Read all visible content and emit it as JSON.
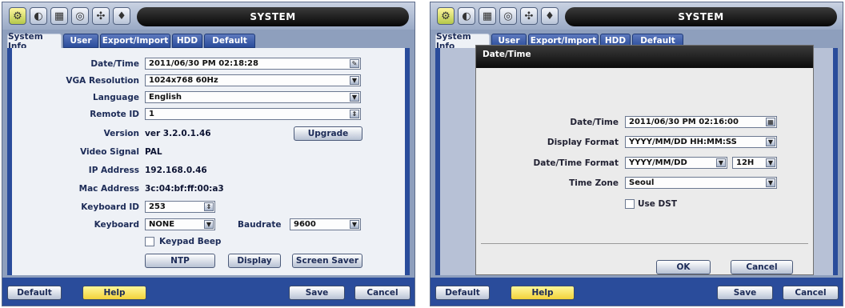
{
  "window": {
    "title": "SYSTEM"
  },
  "toolbar": {
    "icons": [
      "gear-icon",
      "monitor-icon",
      "calendar-icon",
      "camera-icon",
      "network-icon",
      "shield-icon"
    ]
  },
  "tabs": [
    "System Info",
    "User",
    "Export/Import",
    "HDD",
    "Default"
  ],
  "system_info": {
    "date_time_label": "Date/Time",
    "date_time_value": "2011/06/30 PM 02:18:28",
    "vga_label": "VGA Resolution",
    "vga_value": "1024x768  60Hz",
    "language_label": "Language",
    "language_value": "English",
    "remote_id_label": "Remote ID",
    "remote_id_value": "1",
    "version_label": "Version",
    "version_value": "ver 3.2.0.1.46",
    "upgrade_label": "Upgrade",
    "video_signal_label": "Video Signal",
    "video_signal_value": "PAL",
    "ip_label": "IP Address",
    "ip_value": "192.168.0.46",
    "mac_label": "Mac Address",
    "mac_value": "3c:04:bf:ff:00:a3",
    "keyboard_id_label": "Keyboard ID",
    "keyboard_id_value": "253",
    "keyboard_label": "Keyboard",
    "keyboard_value": "NONE",
    "baudrate_label": "Baudrate",
    "baudrate_value": "9600",
    "keypad_beep_label": "Keypad Beep",
    "ntp_label": "NTP",
    "display_label": "Display",
    "screen_saver_label": "Screen Saver"
  },
  "bottom": {
    "default_label": "Default",
    "help_label": "Help",
    "save_label": "Save",
    "cancel_label": "Cancel"
  },
  "dialog": {
    "title": "Date/Time",
    "date_time_label": "Date/Time",
    "date_time_value": "2011/06/30 PM 02:16:00",
    "display_format_label": "Display Format",
    "display_format_value": "YYYY/MM/DD HH:MM:SS",
    "date_time_format_label": "Date/Time Format",
    "date_format_value": "YYYY/MM/DD",
    "hour_format_value": "12H",
    "time_zone_label": "Time Zone",
    "time_zone_value": "Seoul",
    "use_dst_label": "Use DST",
    "ok_label": "OK",
    "cancel_label": "Cancel"
  },
  "colors": {
    "accent": "#2a4c9b",
    "help_yellow": "#f2d23a",
    "title_black": "#070707"
  }
}
